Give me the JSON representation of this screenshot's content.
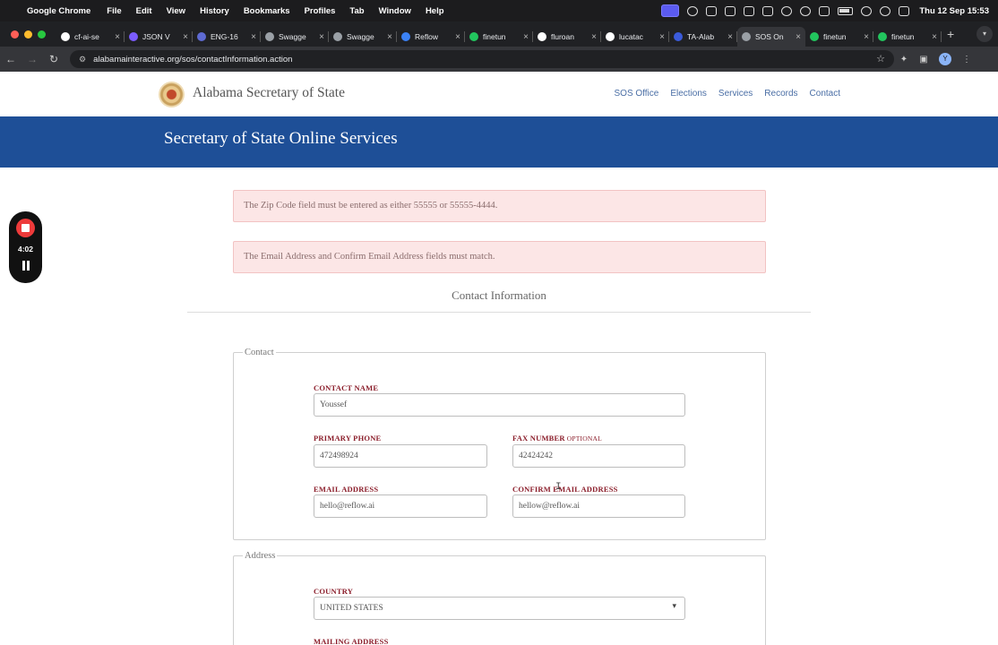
{
  "menubar": {
    "app": "Google Chrome",
    "items": [
      "File",
      "Edit",
      "View",
      "History",
      "Bookmarks",
      "Profiles",
      "Tab",
      "Window",
      "Help"
    ],
    "clock": "Thu 12 Sep  15:53"
  },
  "tabs": [
    {
      "label": "cf-ai-se",
      "color": "#ffffff"
    },
    {
      "label": "JSON V",
      "color": "#7b5cff"
    },
    {
      "label": "ENG-16",
      "color": "#5e6ad2"
    },
    {
      "label": "Swagge",
      "color": "#9aa0a6"
    },
    {
      "label": "Swagge",
      "color": "#9aa0a6"
    },
    {
      "label": "Reflow",
      "color": "#3b82f6"
    },
    {
      "label": "finetun",
      "color": "#22c55e"
    },
    {
      "label": "fluroan",
      "color": "#ffffff"
    },
    {
      "label": "lucatac",
      "color": "#ffffff"
    },
    {
      "label": "TA-Alab",
      "color": "#3b5bdb"
    },
    {
      "label": "SOS On",
      "color": "#9aa0a6",
      "active": true
    },
    {
      "label": "finetun",
      "color": "#22c55e"
    },
    {
      "label": "finetun",
      "color": "#22c55e"
    }
  ],
  "browser": {
    "url": "alabamainteractive.org/sos/contactInformation.action",
    "profile_initial": "Y"
  },
  "site": {
    "title": "Alabama Secretary of State",
    "nav": [
      "SOS Office",
      "Elections",
      "Services",
      "Records",
      "Contact"
    ],
    "banner": "Secretary of State Online Services"
  },
  "alerts": [
    "The Zip Code field must be entered as either 55555 or 55555-4444.",
    "The Email Address and Confirm Email Address fields must match."
  ],
  "form": {
    "section_title": "Contact Information",
    "contact_legend": "Contact",
    "contact_name_label": "CONTACT NAME",
    "contact_name_value": "Youssef",
    "primary_phone_label": "PRIMARY PHONE",
    "primary_phone_value": "472498924",
    "fax_label": "FAX NUMBER",
    "fax_optional": "OPTIONAL",
    "fax_value": "42424242",
    "email_label": "EMAIL ADDRESS",
    "email_value": "hello@reflow.ai",
    "confirm_email_label": "CONFIRM EMAIL ADDRESS",
    "confirm_email_value": "hellow@reflow.ai",
    "address_legend": "Address",
    "country_label": "COUNTRY",
    "country_value": "UNITED STATES",
    "mailing_label": "MAILING ADDRESS"
  },
  "recorder": {
    "time": "4:02"
  }
}
